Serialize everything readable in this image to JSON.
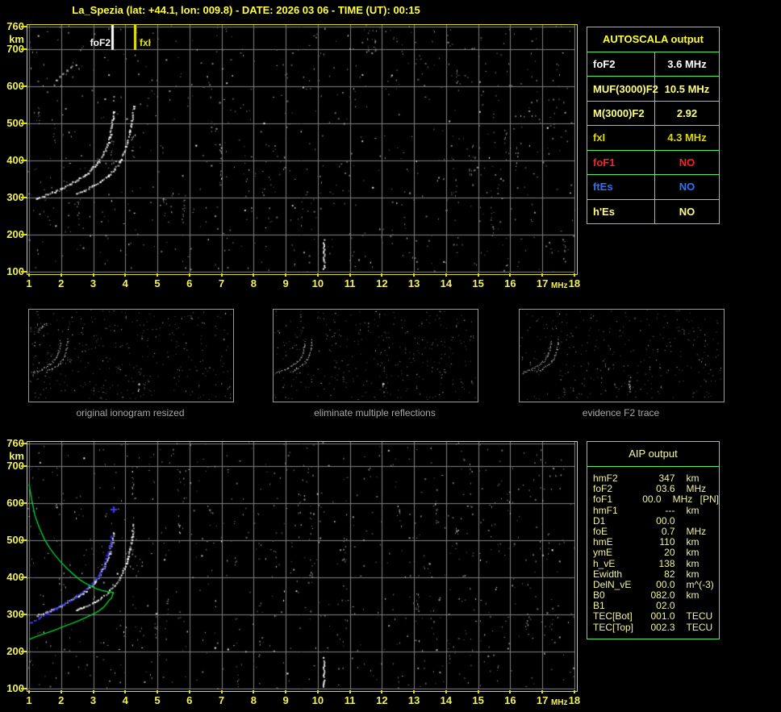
{
  "title": "La_Spezia (lat: +44.1, lon: 009.8) - DATE: 2026 03 06 - TIME (UT): 00:15",
  "colors": {
    "background": "#000000",
    "title_yellow": "#ffff3c",
    "axis_label_yellow": "#f1f15a",
    "frame_yellow": "#e0e000",
    "grid_gray": "#808080",
    "table_border_green": "#55f055",
    "trace_white": "#ffffff",
    "profile_green": "#00cc33",
    "restored_trace_blue": "#2424ee",
    "caption_gray": "#a8a8a8"
  },
  "axes": {
    "x_ticks": [
      "1",
      "2",
      "3",
      "4",
      "5",
      "6",
      "7",
      "8",
      "9",
      "10",
      "11",
      "12",
      "13",
      "14",
      "15",
      "16",
      "17",
      "18"
    ],
    "x_unit": "MHz",
    "y_ticks": [
      "760",
      "700",
      "600",
      "500",
      "400",
      "300",
      "200",
      "100"
    ],
    "y_tick_km": [
      760,
      700,
      600,
      500,
      400,
      300,
      200,
      100
    ],
    "y_unit": "km",
    "x_range": [
      1,
      18
    ],
    "y_range": [
      100,
      760
    ]
  },
  "autoscala": {
    "title": "AUTOSCALA output",
    "rows": [
      {
        "name": "foF2",
        "value": "3.6 MHz",
        "color": "#ffffff"
      },
      {
        "name": "MUF(3000)F2",
        "value": "10.5 MHz",
        "color": "#ffff85"
      },
      {
        "name": "M(3000)F2",
        "value": "2.92",
        "color": "#ffff85"
      },
      {
        "name": "fxI",
        "value": "4.3 MHz",
        "color": "#d8d800"
      },
      {
        "name": "foF1",
        "value": "NO",
        "color": "#ff1f1f"
      },
      {
        "name": "ftEs",
        "value": "NO",
        "color": "#2f72ff"
      },
      {
        "name": "h'Es",
        "value": "NO",
        "color": "#ffff85"
      }
    ]
  },
  "thumbnails": [
    {
      "caption": "original ionogram resized"
    },
    {
      "caption": "eliminate multiple reflections"
    },
    {
      "caption": "evidence F2 trace"
    }
  ],
  "aip": {
    "title": "AIP output",
    "rows": [
      {
        "name": "hmF2",
        "value": "347",
        "unit": "km",
        "note": ""
      },
      {
        "name": "foF2",
        "value": "03.6",
        "unit": "MHz",
        "note": ""
      },
      {
        "name": "foF1",
        "value": "00.0",
        "unit": "MHz",
        "note": "[PN]"
      },
      {
        "name": "hmF1",
        "value": "---",
        "unit": "km",
        "note": ""
      },
      {
        "name": "D1",
        "value": "00.0",
        "unit": "",
        "note": ""
      },
      {
        "name": "foE",
        "value": "0.7",
        "unit": "MHz",
        "note": ""
      },
      {
        "name": "hmE",
        "value": "110",
        "unit": "km",
        "note": ""
      },
      {
        "name": "ymE",
        "value": "20",
        "unit": "km",
        "note": ""
      },
      {
        "name": "h_vE",
        "value": "138",
        "unit": "km",
        "note": ""
      },
      {
        "name": "Ewidth",
        "value": "82",
        "unit": "km",
        "note": ""
      },
      {
        "name": "DelN_vE",
        "value": "00.0",
        "unit": "m^(-3)",
        "note": ""
      },
      {
        "name": "B0",
        "value": "082.0",
        "unit": "km",
        "note": ""
      },
      {
        "name": "B1",
        "value": "02.0",
        "unit": "",
        "note": ""
      },
      {
        "name": "TEC[Bot]",
        "value": "001.0",
        "unit": "TECU",
        "note": ""
      },
      {
        "name": "TEC[Top]",
        "value": "002.3",
        "unit": "TECU",
        "note": ""
      }
    ]
  },
  "chart_data": [
    {
      "type": "scatter",
      "title": "ionogram with AUTOSCALA markers",
      "xlabel": "MHz",
      "ylabel": "km",
      "xlim": [
        1,
        18
      ],
      "ylim": [
        100,
        760
      ],
      "grid": true,
      "markers": [
        {
          "name": "foF2",
          "x": 3.6,
          "color": "#ffffff"
        },
        {
          "name": "fxI",
          "x": 4.3,
          "color": "#eaea00"
        }
      ],
      "noise_streak": {
        "x": 10.2,
        "y_range": [
          108,
          192
        ]
      },
      "series": [
        {
          "name": "F2 O-mode trace",
          "style": "dots",
          "step": 2.3,
          "palette": [
            "#ffffff",
            "#e0e0e0",
            "#a8a8a8"
          ],
          "points": [
            [
              1.2,
              299
            ],
            [
              1.45,
              306
            ],
            [
              1.7,
              314
            ],
            [
              2.0,
              325
            ],
            [
              2.25,
              337
            ],
            [
              2.5,
              350
            ],
            [
              2.75,
              364
            ],
            [
              2.95,
              379
            ],
            [
              3.15,
              398
            ],
            [
              3.3,
              418
            ],
            [
              3.42,
              442
            ],
            [
              3.5,
              466
            ],
            [
              3.56,
              492
            ],
            [
              3.6,
              515
            ],
            [
              3.62,
              532
            ]
          ]
        },
        {
          "name": "F2 X-mode trace",
          "style": "dots",
          "step": 2.6,
          "palette": [
            "#ffffff",
            "#d2d2d2",
            "#9a9a9a"
          ],
          "points": [
            [
              2.45,
              312
            ],
            [
              2.7,
              320
            ],
            [
              2.95,
              331
            ],
            [
              3.2,
              344
            ],
            [
              3.45,
              360
            ],
            [
              3.65,
              378
            ],
            [
              3.82,
              400
            ],
            [
              3.95,
              424
            ],
            [
              4.05,
              450
            ],
            [
              4.13,
              477
            ],
            [
              4.18,
              502
            ],
            [
              4.22,
              525
            ],
            [
              4.24,
              545
            ]
          ]
        },
        {
          "name": "second-hop echo",
          "style": "dots",
          "step": 4.5,
          "palette": [
            "#c8c8c8",
            "#8a8a8a"
          ],
          "points": [
            [
              1.75,
              605
            ],
            [
              1.85,
              616
            ],
            [
              1.95,
              627
            ],
            [
              2.05,
              636
            ],
            [
              2.15,
              644
            ],
            [
              2.3,
              653
            ],
            [
              2.45,
              660
            ]
          ]
        }
      ]
    },
    {
      "type": "scatter",
      "title": "ionogram with AIP restored trace and electron density profile",
      "xlabel": "MHz",
      "ylabel": "km",
      "xlim": [
        1,
        18
      ],
      "ylim": [
        100,
        760
      ],
      "grid": true,
      "noise_streak": {
        "x": 10.2,
        "y_range": [
          105,
          185
        ]
      },
      "cross": [
        3.64,
        582
      ],
      "series": [
        {
          "name": "F2 O-mode trace",
          "style": "dots",
          "step": 2.3,
          "palette": [
            "#ffffff",
            "#e0e0e0",
            "#a8a8a8"
          ],
          "points": [
            [
              1.23,
              299
            ],
            [
              1.5,
              307
            ],
            [
              1.73,
              315
            ],
            [
              2.0,
              326
            ],
            [
              2.23,
              337
            ],
            [
              2.5,
              350
            ],
            [
              2.65,
              358
            ],
            [
              2.99,
              383
            ],
            [
              3.2,
              408
            ],
            [
              3.36,
              437
            ],
            [
              3.49,
              466
            ],
            [
              3.57,
              495
            ],
            [
              3.62,
              523
            ]
          ]
        },
        {
          "name": "F2 X-mode trace",
          "style": "dots",
          "step": 2.6,
          "palette": [
            "#ffffff",
            "#d2d2d2",
            "#9a9a9a"
          ],
          "points": [
            [
              2.45,
              312
            ],
            [
              2.7,
              320
            ],
            [
              2.95,
              331
            ],
            [
              3.2,
              344
            ],
            [
              3.45,
              360
            ],
            [
              3.65,
              378
            ],
            [
              3.82,
              400
            ],
            [
              3.95,
              424
            ],
            [
              4.05,
              450
            ],
            [
              4.13,
              477
            ],
            [
              4.18,
              502
            ],
            [
              4.22,
              525
            ],
            [
              4.24,
              545
            ]
          ]
        },
        {
          "name": "AIP restored trace",
          "style": "dots",
          "step": 2.8,
          "palette": [
            "#2424ee",
            "#4646ff"
          ],
          "points": [
            [
              1.02,
              279
            ],
            [
              1.3,
              291
            ],
            [
              1.56,
              304
            ],
            [
              1.8,
              316
            ],
            [
              2.06,
              328
            ],
            [
              2.27,
              339
            ],
            [
              2.48,
              351
            ],
            [
              2.67,
              363
            ],
            [
              2.86,
              376
            ],
            [
              3.0,
              388
            ],
            [
              3.11,
              401
            ],
            [
              3.2,
              414
            ],
            [
              3.28,
              430
            ],
            [
              3.35,
              444
            ],
            [
              3.41,
              459
            ],
            [
              3.45,
              472
            ],
            [
              3.49,
              487
            ],
            [
              3.52,
              500
            ],
            [
              3.55,
              513
            ]
          ]
        },
        {
          "name": "electron density profile",
          "style": "line",
          "color": "#00cc33",
          "points": [
            [
              1.0,
              650
            ],
            [
              1.08,
              610
            ],
            [
              1.18,
              567
            ],
            [
              1.32,
              533
            ],
            [
              1.48,
              502
            ],
            [
              1.64,
              479
            ],
            [
              1.81,
              459
            ],
            [
              2.0,
              440
            ],
            [
              2.19,
              423
            ],
            [
              2.38,
              408
            ],
            [
              2.57,
              394
            ],
            [
              2.75,
              384
            ],
            [
              2.94,
              376
            ],
            [
              3.1,
              369
            ],
            [
              3.28,
              364
            ],
            [
              3.45,
              361
            ],
            [
              3.62,
              359
            ],
            [
              3.58,
              345
            ],
            [
              3.49,
              337
            ],
            [
              3.4,
              327
            ],
            [
              3.32,
              319
            ],
            [
              3.2,
              311
            ],
            [
              3.07,
              304
            ],
            [
              2.9,
              297
            ],
            [
              2.74,
              290
            ],
            [
              2.53,
              282
            ],
            [
              2.32,
              275
            ],
            [
              2.1,
              268
            ],
            [
              1.9,
              261
            ],
            [
              1.68,
              254
            ],
            [
              1.48,
              248
            ],
            [
              1.28,
              242
            ],
            [
              1.1,
              236
            ],
            [
              1.0,
              232
            ]
          ]
        }
      ]
    }
  ]
}
